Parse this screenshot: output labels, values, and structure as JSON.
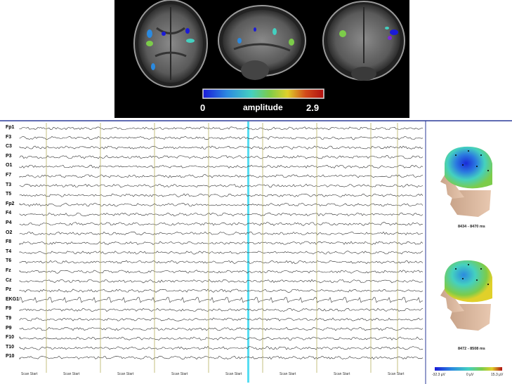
{
  "mri_panel": {
    "colorbar": {
      "min": "0",
      "label": "amplitude",
      "max": "2.9",
      "colors": [
        "#1a1ad8",
        "#2b8ae0",
        "#44d0c0",
        "#7ccc4a",
        "#e0d02a",
        "#d24a1a",
        "#b01010"
      ]
    }
  },
  "eeg": {
    "channels": [
      "Fp1",
      "F3",
      "C3",
      "P3",
      "O1",
      "F7",
      "T3",
      "T5",
      "Fp2",
      "F4",
      "P4",
      "O2",
      "F8",
      "T4",
      "T6",
      "Fz",
      "Cz",
      "Pz",
      "EKG1",
      "F9",
      "T9",
      "P9",
      "F10",
      "T10",
      "P10"
    ],
    "marker_label": "Scan Start",
    "scan_markers": [
      {
        "label": "Scan Start"
      },
      {
        "label": "Scan Start"
      },
      {
        "label": "Scan Start"
      },
      {
        "label": "Scan Start"
      },
      {
        "label": "Scan Start"
      },
      {
        "label": "Scan Start"
      },
      {
        "label": "Scan Start"
      },
      {
        "label": "Scan Start"
      },
      {
        "label": "Scan Start"
      }
    ],
    "first_marker_label": "Scan Start",
    "highlight_color": "#3ad8f0"
  },
  "topo_maps": [
    {
      "time_range": "8434 - 8470 ms"
    },
    {
      "time_range": "8472 - 8508 ms"
    }
  ],
  "topo_scale": {
    "min": "-32.3 µV",
    "mid": "0 µV",
    "max": "15.3 µV"
  }
}
